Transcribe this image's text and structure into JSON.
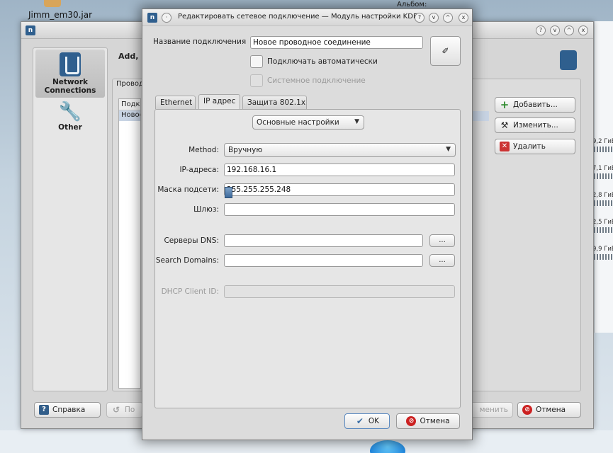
{
  "desktop": {
    "icon_label": "Jimm_em30.jar",
    "album_label": "Альбом:",
    "gb_values": [
      "9,2 ГиБ",
      "7,1 ГиБ",
      "2,8 ГиБ",
      "2,5 ГиБ",
      "9,9 ГиБ"
    ]
  },
  "bg_window": {
    "sidebar": [
      {
        "label_line1": "Network",
        "label_line2": "Connections",
        "icon": "network-connections-icon",
        "selected": true
      },
      {
        "label_line1": "Other",
        "label_line2": "",
        "icon": "wrench-icon",
        "selected": false
      }
    ],
    "content_title": "Add, E",
    "tab_label": "Провод",
    "list_header": "Подкл",
    "list_row": "Новое",
    "buttons": {
      "add": "Добавить...",
      "edit": "Изменить...",
      "delete": "Удалить",
      "help": "Справка",
      "partial_left": "По",
      "partial_right": "менить",
      "cancel": "Отмена"
    }
  },
  "dialog": {
    "title": "Редактировать сетевое подключение — Модуль настройки KDE",
    "connection_name_label": "Название подключения",
    "connection_name_value": "Новое проводное соединение",
    "auto_connect_label": "Подключать автоматически",
    "system_connection_label": "Системное подключение",
    "tabs": [
      "Ethernet",
      "IP адрес",
      "Защита 802.1x"
    ],
    "active_tab": 1,
    "settings_combo": "Основные настройки",
    "method_label": "Method:",
    "method_value": "Вручную",
    "ip_label": "IP-адреса:",
    "ip_value": "192.168.16.1",
    "mask_label": "Маска подсети:",
    "mask_value": "255.255.255.248",
    "gateway_label": "Шлюз:",
    "gateway_value": "",
    "dns_label": "Серверы DNS:",
    "dns_value": "",
    "search_label": "Search Domains:",
    "search_value": "",
    "dhcp_label": "DHCP Client ID:",
    "dhcp_value": "",
    "ellipsis": "...",
    "ok": "OK",
    "cancel": "Отмена"
  },
  "colors": {
    "accent": "#2f5f8e",
    "window_bg": "#dcdcdc",
    "selection": "#c8d4e4",
    "danger": "#cc3333"
  }
}
